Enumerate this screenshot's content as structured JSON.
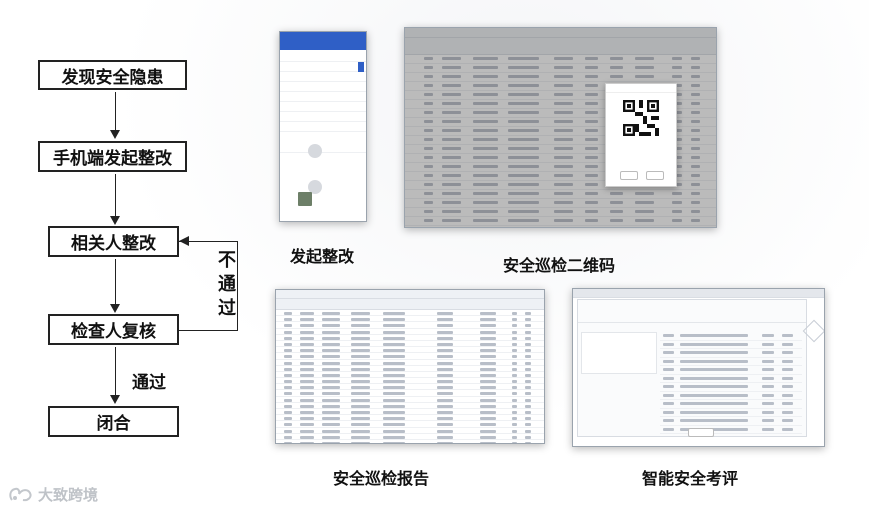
{
  "flowchart": {
    "steps": [
      "发现安全隐患",
      "手机端发起整改",
      "相关人整改",
      "检查人复核",
      "闭合"
    ],
    "fail_label": "不通过",
    "pass_label": "通过"
  },
  "captions": {
    "mobile": "发起整改",
    "qrcode": "安全巡检二维码",
    "report": "安全巡检报告",
    "evaluation": "智能安全考评"
  },
  "logo": {
    "text": "大致跨境"
  },
  "colors": {
    "accent_blue": "#2f5fc6",
    "primary_button": "#2f6fd6",
    "text": "#111111"
  },
  "icons": [
    "logo-icon",
    "qr-code-icon"
  ]
}
